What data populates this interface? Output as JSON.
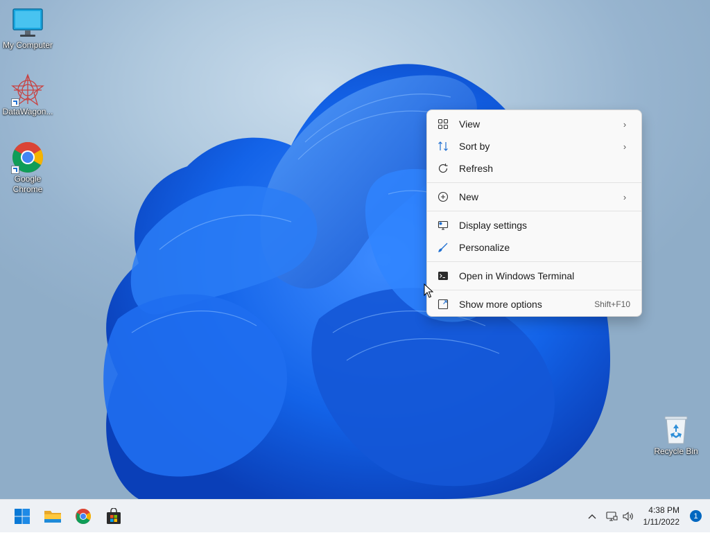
{
  "desktop": {
    "icons": [
      {
        "label": "My Computer",
        "icon": "monitor-icon"
      },
      {
        "label": "DataWagon...",
        "icon": "datawagon-icon"
      },
      {
        "label": "Google Chrome",
        "icon": "chrome-icon"
      },
      {
        "label": "Recycle Bin",
        "icon": "recycle-bin-icon"
      }
    ]
  },
  "context_menu": {
    "items": [
      {
        "label": "View",
        "icon": "view-grid-icon",
        "submenu": true
      },
      {
        "label": "Sort by",
        "icon": "sort-icon",
        "submenu": true
      },
      {
        "label": "Refresh",
        "icon": "refresh-icon"
      },
      {
        "label": "New",
        "icon": "new-plus-icon",
        "submenu": true
      },
      {
        "label": "Display settings",
        "icon": "display-settings-icon"
      },
      {
        "label": "Personalize",
        "icon": "brush-icon"
      },
      {
        "label": "Open in Windows Terminal",
        "icon": "terminal-icon"
      },
      {
        "label": "Show more options",
        "icon": "show-more-icon",
        "shortcut": "Shift+F10"
      }
    ]
  },
  "taskbar": {
    "apps": [
      {
        "name": "Start",
        "icon": "windows-start-icon"
      },
      {
        "name": "File Explorer",
        "icon": "file-explorer-icon"
      },
      {
        "name": "Google Chrome",
        "icon": "chrome-icon"
      },
      {
        "name": "Microsoft Store",
        "icon": "store-icon"
      }
    ],
    "tray": {
      "time": "4:38 PM",
      "date": "1/11/2022",
      "notification_count": "1",
      "icons": [
        "chevron-up-icon",
        "network-icon",
        "volume-icon"
      ]
    }
  },
  "colors": {
    "accent": "#0067c0",
    "bloom": "#1e6ff0",
    "menu_bg": "#f9f9f9"
  }
}
